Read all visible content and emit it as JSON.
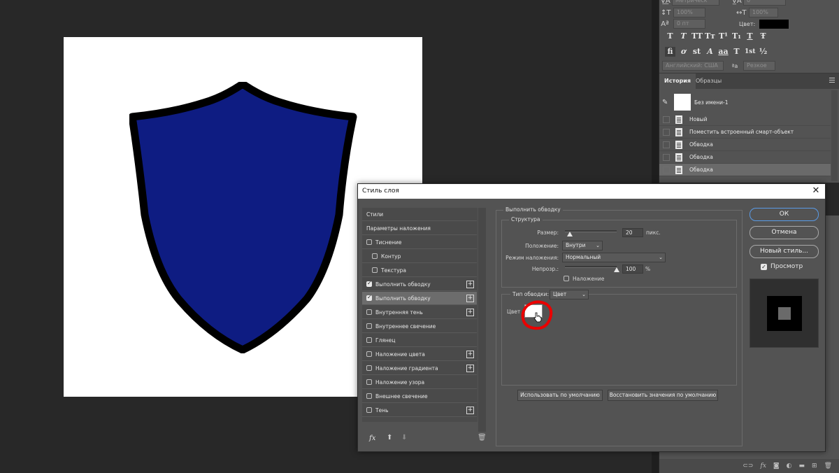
{
  "character_panel": {
    "language": "Английский: США",
    "antialias": "Резкое",
    "color_label": "Цвет:",
    "tracking_unit": "Метрическ",
    "tracking_value": "0",
    "vscale": "100%",
    "hscale": "100%",
    "baseline": "0 пт",
    "type_style_buttons": [
      "T",
      "T",
      "TT",
      "Tт",
      "T¹",
      "T₁",
      "T",
      "Ŧ"
    ],
    "opentype_buttons": [
      "fi",
      "ơ",
      "st",
      "A",
      "aa",
      "T",
      "1st",
      "½"
    ],
    "text_color": "#000000"
  },
  "history_panel": {
    "tabs": [
      "История",
      "Образцы"
    ],
    "snapshot": "Без имени-1",
    "items": [
      {
        "label": "Новый"
      },
      {
        "label": "Поместить встроенный смарт-объект"
      },
      {
        "label": "Обводка"
      },
      {
        "label": "Обводка"
      },
      {
        "label": "Обводка",
        "selected": true
      }
    ]
  },
  "canvas": {
    "shield_fill": "#0e1c82",
    "shield_stroke": "#000000"
  },
  "dialog": {
    "title": "Стиль слоя",
    "styles": [
      {
        "label": "Стили",
        "indent": 0
      },
      {
        "label": "Параметры наложения",
        "indent": 0
      },
      {
        "label": "Тиснение",
        "checkbox": true,
        "checked": false,
        "indent": 0
      },
      {
        "label": "Контур",
        "checkbox": true,
        "checked": false,
        "indent": 1
      },
      {
        "label": "Текстура",
        "checkbox": true,
        "checked": false,
        "indent": 1
      },
      {
        "label": "Выполнить обводку",
        "checkbox": true,
        "checked": true,
        "plus": true,
        "indent": 0
      },
      {
        "label": "Выполнить обводку",
        "checkbox": true,
        "checked": true,
        "plus": true,
        "selected": true,
        "indent": 0
      },
      {
        "label": "Внутренняя тень",
        "checkbox": true,
        "checked": false,
        "plus": true,
        "indent": 0
      },
      {
        "label": "Внутреннее свечение",
        "checkbox": true,
        "checked": false,
        "indent": 0
      },
      {
        "label": "Глянец",
        "checkbox": true,
        "checked": false,
        "indent": 0
      },
      {
        "label": "Наложение цвета",
        "checkbox": true,
        "checked": false,
        "plus": true,
        "indent": 0
      },
      {
        "label": "Наложение градиента",
        "checkbox": true,
        "checked": false,
        "plus": true,
        "indent": 0
      },
      {
        "label": "Наложение узора",
        "checkbox": true,
        "checked": false,
        "indent": 0
      },
      {
        "label": "Внешнее свечение",
        "checkbox": true,
        "checked": false,
        "indent": 0
      },
      {
        "label": "Тень",
        "checkbox": true,
        "checked": false,
        "plus": true,
        "indent": 0
      }
    ],
    "footer_fx": "fx",
    "section_title": "Выполнить обводку",
    "structure": {
      "title": "Структура",
      "size_label": "Размер:",
      "size_value": "20",
      "size_unit": "пикс.",
      "size_fraction": 0.1,
      "position_label": "Положение:",
      "position_value": "Внутри",
      "blend_label": "Режим наложения:",
      "blend_value": "Нормальный",
      "opacity_label": "Непрозр.:",
      "opacity_value": "100",
      "opacity_unit": "%",
      "opacity_fraction": 1.0,
      "overprint_label": "Наложение"
    },
    "fill_type": {
      "label": "Тип обводки:",
      "value": "Цвет",
      "color_label": "Цвет",
      "swatch_color": "#ffffff"
    },
    "make_default": "Использовать по умолчанию",
    "reset_default": "Восстановить значения по умолчанию",
    "ok": "ОК",
    "cancel": "Отмена",
    "new_style": "Новый стиль...",
    "preview_label": "Просмотр",
    "preview_checked": true
  }
}
